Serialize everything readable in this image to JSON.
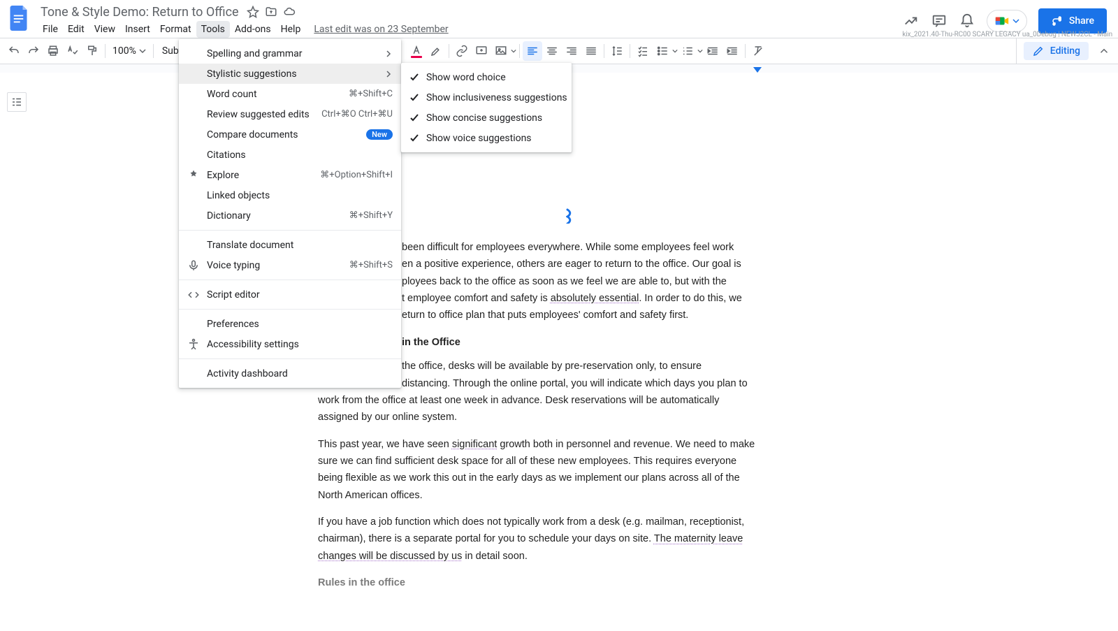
{
  "title": "Tone & Style Demo: Return to Office",
  "menubar": {
    "file": "File",
    "edit": "Edit",
    "view": "View",
    "insert": "Insert",
    "format": "Format",
    "tools": "Tools",
    "addons": "Add-ons",
    "help": "Help",
    "lastedit": "Last edit was on 23 September"
  },
  "debug_line": "kix_2021.40-Thu-RC00 SCARY LEGACY ua_0Debug | NEWJ2CL - Main",
  "share_label": "Share",
  "toolbar": {
    "zoom": "100%",
    "style": "Subtitle",
    "mode": "Editing"
  },
  "tools_menu": {
    "spelling": {
      "label": "Spelling and grammar"
    },
    "stylistic": {
      "label": "Stylistic suggestions"
    },
    "wordcount": {
      "label": "Word count",
      "shortcut": "⌘+Shift+C"
    },
    "review": {
      "label": "Review suggested edits",
      "shortcut": "Ctrl+⌘O Ctrl+⌘U"
    },
    "compare": {
      "label": "Compare documents",
      "badge": "New"
    },
    "citations": {
      "label": "Citations"
    },
    "explore": {
      "label": "Explore",
      "shortcut": "⌘+Option+Shift+I"
    },
    "linked": {
      "label": "Linked objects"
    },
    "dictionary": {
      "label": "Dictionary",
      "shortcut": "⌘+Shift+Y"
    },
    "translate": {
      "label": "Translate document"
    },
    "voice": {
      "label": "Voice typing",
      "shortcut": "⌘+Shift+S"
    },
    "script": {
      "label": "Script editor"
    },
    "prefs": {
      "label": "Preferences"
    },
    "a11y": {
      "label": "Accessibility settings"
    },
    "activity": {
      "label": "Activity dashboard"
    }
  },
  "stylistic_submenu": {
    "wordchoice": "Show word choice",
    "inclusiveness": "Show inclusiveness suggestions",
    "concise": "Show concise suggestions",
    "voice": "Show voice suggestions"
  },
  "document": {
    "p1a": "been difficult for employees everywhere. While some employees feel work",
    "p1b": "en a positive experience, others are eager to return to the office. Our goal is",
    "p1c": "ployees back to the office as soon as we feel we are able to, but with the",
    "p1d_a": "t employee comfort and safety is ",
    "p1d_u": "absolutely essential",
    "p1d_b": ". In order to do this, we",
    "p1e": "eturn to office plan that puts employees' comfort and safety first.",
    "sub1_a": " in the Office",
    "p2a": " the office, desks will be available by pre-reservation only, to ensure",
    "p2b": " distancing. Through the online portal, you will indicate which days you plan to",
    "p2c": "work from the office at least one week in advance.  Desk reservations will be automatically assigned by our online system.",
    "p3a": "This past year, we have seen ",
    "p3u": "significant",
    "p3b": " growth both in personnel and revenue. We need to make sure we can find sufficient desk space for all of these new employees. This requires everyone being flexible as we work this out in the early days as we implement our plans across all of the North American offices.",
    "p4a": "If you have a job function which does not typically work from a desk (e.g. mailman, receptionist, chairman), there is a separate portal for you to schedule your days on site. ",
    "p4u": "The maternity leave changes will be discussed by us",
    "p4b": " in detail soon.",
    "sub2": "Rules in the office"
  }
}
